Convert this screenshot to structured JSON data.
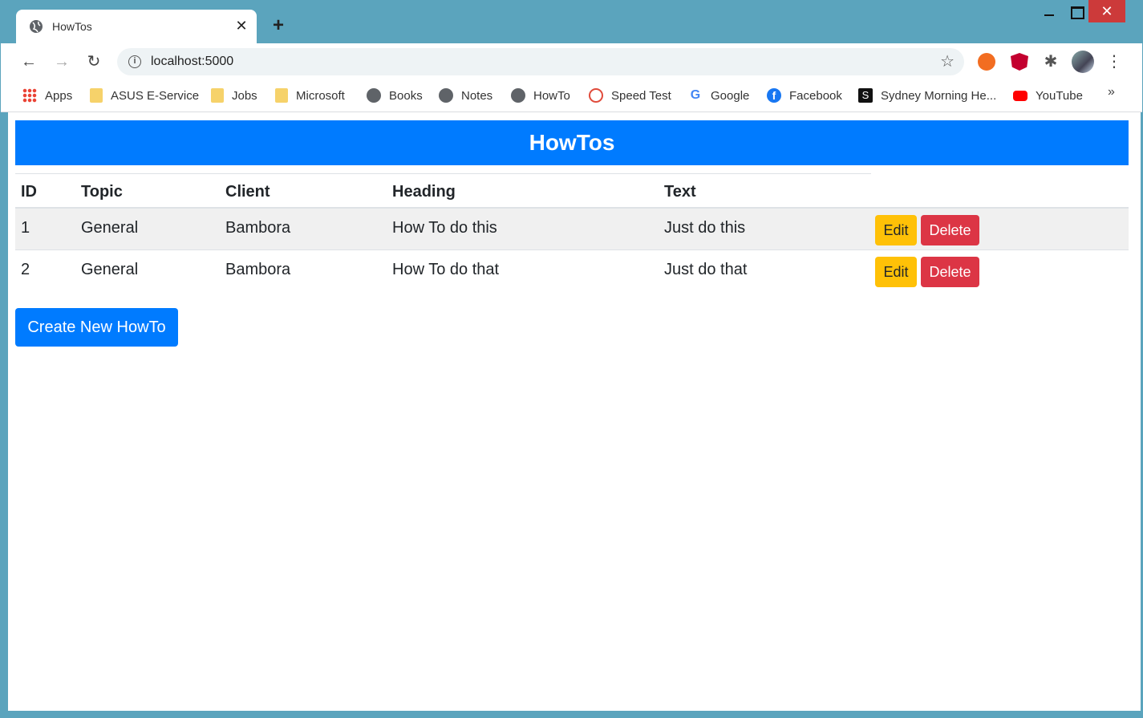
{
  "browser": {
    "tab_title": "HowTos",
    "new_tab_symbol": "+",
    "close_tab_symbol": "✕",
    "url": "localhost:5000",
    "bookmarks": [
      "Apps",
      "ASUS E-Service",
      "Jobs",
      "Microsoft",
      "Books",
      "Notes",
      "HowTo",
      "Speed Test",
      "Google",
      "Facebook",
      "Sydney Morning He...",
      "YouTube"
    ],
    "bookmarks_more": "»"
  },
  "page": {
    "title": "HowTos",
    "columns": [
      "ID",
      "Topic",
      "Client",
      "Heading",
      "Text"
    ],
    "rows": [
      {
        "id": "1",
        "topic": "General",
        "client": "Bambora",
        "heading": "How To do this",
        "text": "Just do this"
      },
      {
        "id": "2",
        "topic": "General",
        "client": "Bambora",
        "heading": "How To do that",
        "text": "Just do that"
      }
    ],
    "edit_label": "Edit",
    "delete_label": "Delete",
    "create_label": "Create New HowTo"
  },
  "colors": {
    "primary": "#007bff",
    "warning": "#ffc107",
    "danger": "#dc3545",
    "window_frame": "#5ba4bd"
  }
}
